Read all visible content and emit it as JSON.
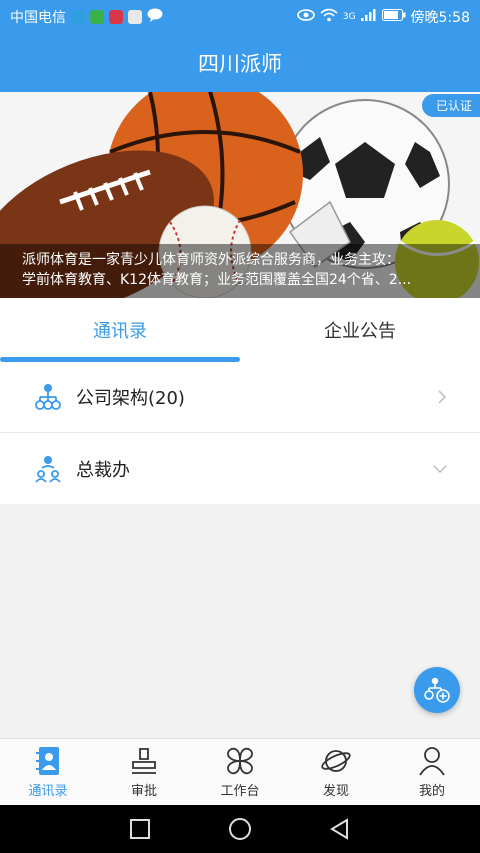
{
  "statusbar": {
    "carrier": "中国电信",
    "network": "3G",
    "time_text": "傍晚5:58"
  },
  "header": {
    "title": "四川派师"
  },
  "banner": {
    "badge": "已认证",
    "caption_line1": "派师体育是一家青少儿体育师资外派综合服务商，业务主攻：",
    "caption_line2": "学前体育教育、K12体育教育；业务范围覆盖全国24个省、2..."
  },
  "tabs": [
    {
      "label": "通讯录",
      "active": true
    },
    {
      "label": "企业公告",
      "active": false
    }
  ],
  "list": [
    {
      "label": "公司架构(20)",
      "icon": "org-chart-icon",
      "arrow": "chevron-right-icon"
    },
    {
      "label": "总裁办",
      "icon": "department-icon",
      "arrow": "chevron-down-icon"
    }
  ],
  "bottom_nav": [
    {
      "label": "通讯录",
      "icon": "contacts-icon",
      "active": true
    },
    {
      "label": "审批",
      "icon": "approval-stamp-icon",
      "active": false
    },
    {
      "label": "工作台",
      "icon": "workbench-icon",
      "active": false
    },
    {
      "label": "发现",
      "icon": "planet-icon",
      "active": false
    },
    {
      "label": "我的",
      "icon": "user-icon",
      "active": false
    }
  ],
  "colors": {
    "accent": "#3a9aeb",
    "background": "#f2f2f2"
  }
}
